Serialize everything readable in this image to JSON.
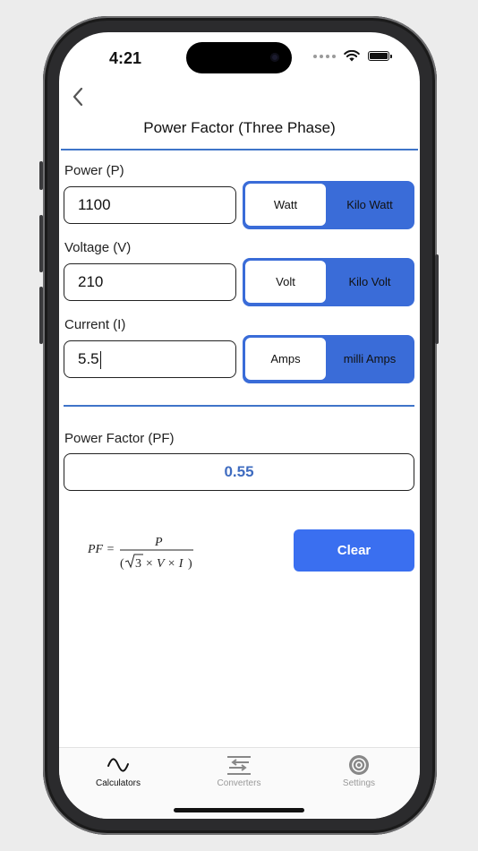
{
  "status_bar": {
    "time": "4:21"
  },
  "header": {
    "title": "Power Factor (Three Phase)"
  },
  "fields": [
    {
      "label": "Power (P)",
      "value": "1100",
      "unit_left": "Watt",
      "unit_right": "Kilo Watt"
    },
    {
      "label": "Voltage (V)",
      "value": "210",
      "unit_left": "Volt",
      "unit_right": "Kilo Volt"
    },
    {
      "label": "Current (I)",
      "value": "5.5",
      "unit_left": "Amps",
      "unit_right": "milli Amps"
    }
  ],
  "result": {
    "label": "Power Factor (PF)",
    "value": "0.55"
  },
  "formula": {
    "lhs": "PF =",
    "numerator": "P",
    "denominator_sqrt": "3",
    "denominator_rest": "× V × I"
  },
  "actions": {
    "clear_label": "Clear"
  },
  "tabs": [
    {
      "label": "Calculators",
      "icon": "sine-wave-icon",
      "active": true
    },
    {
      "label": "Converters",
      "icon": "swap-arrows-icon",
      "active": false
    },
    {
      "label": "Settings",
      "icon": "gear-icon",
      "active": false
    }
  ],
  "colors": {
    "accent": "#3a6ff0",
    "segment": "#3a6cd8",
    "result_text": "#3f6cc0",
    "rule": "#3f74c9"
  }
}
